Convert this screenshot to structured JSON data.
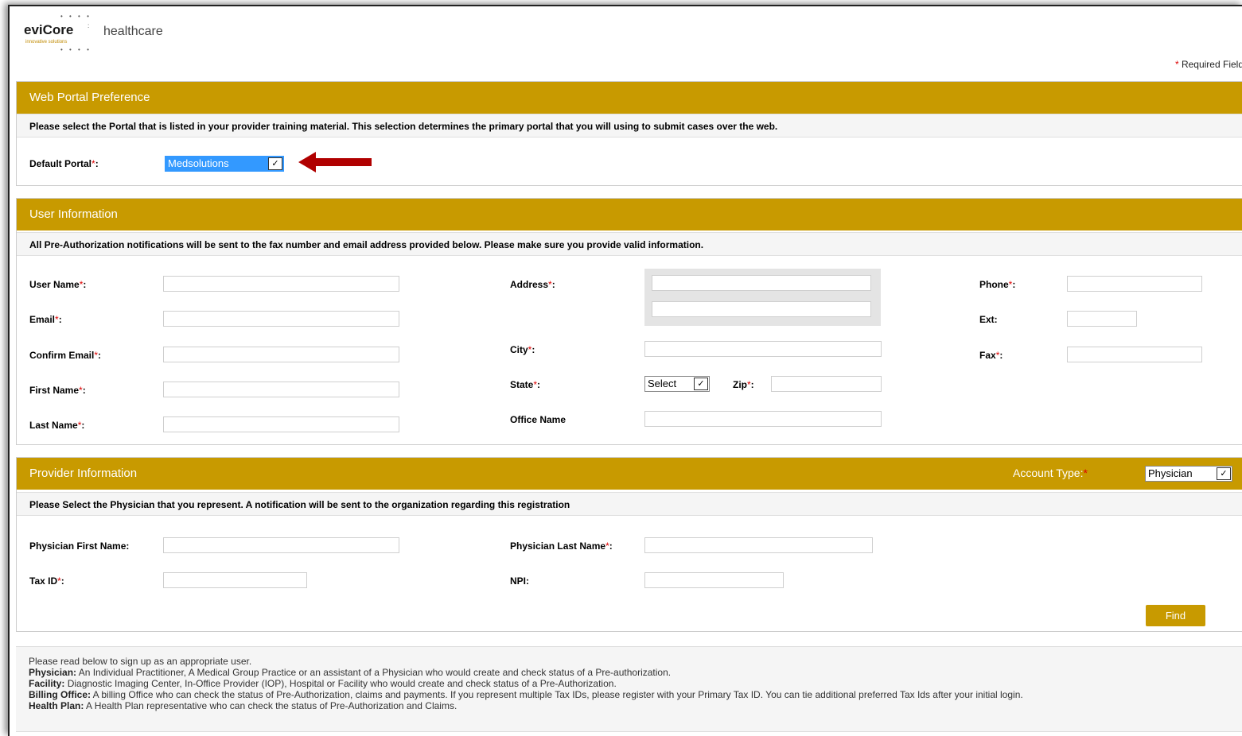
{
  "branding": {
    "logo_name": "eviCore",
    "logo_suffix": "healthcare",
    "logo_tagline": "innovative solutions"
  },
  "required_note": {
    "star": "*",
    "text": "Required Field"
  },
  "web_portal": {
    "title": "Web Portal Preference",
    "note": "Please select the Portal that is listed in your provider training material. This selection determines the primary portal that you will using to submit cases over the web.",
    "default_portal_label": "Default Portal",
    "default_portal_value": "Medsolutions",
    "arrow_color": "#b00000"
  },
  "user_info": {
    "title": "User Information",
    "note": "All Pre-Authorization notifications will be sent to the fax number and email address provided below. Please make sure you provide valid information.",
    "labels": {
      "user_name": "User Name",
      "email": "Email",
      "confirm_email": "Confirm Email",
      "first_name": "First Name",
      "last_name": "Last Name",
      "address": "Address",
      "city": "City",
      "state": "State",
      "zip": "Zip",
      "office_name": "Office Name",
      "phone": "Phone",
      "ext": "Ext:",
      "fax": "Fax"
    },
    "state_value": "Select"
  },
  "provider_info": {
    "title": "Provider Information",
    "account_type_label": "Account Type:",
    "account_type_value": "Physician",
    "note": "Please Select the Physician that you represent. A notification will be sent to the organization regarding this registration",
    "labels": {
      "physician_first_name": "Physician First Name:",
      "physician_last_name": "Physician Last Name",
      "tax_id": "Tax ID",
      "npi": "NPI:"
    },
    "find_button": "Find"
  },
  "help": {
    "intro": "Please read below to sign up as an appropriate user.",
    "items": [
      {
        "term": "Physician:",
        "desc": " An Individual Practitioner, A Medical Group Practice or an assistant of a Physician who would create and check status of a Pre-authorization."
      },
      {
        "term": "Facility:",
        "desc": " Diagnostic Imaging Center, In-Office Provider (IOP), Hospital or Facility who would create and check status of a Pre-Authorization."
      },
      {
        "term": "Billing Office:",
        "desc": " A billing Office who can check the status of Pre-Authorization, claims and payments. If you represent multiple Tax IDs, please register with your Primary Tax ID. You can tie additional preferred Tax Ids after your initial login."
      },
      {
        "term": "Health Plan:",
        "desc": " A Health Plan representative who can check the status of Pre-Authorization and Claims."
      }
    ]
  },
  "colors": {
    "header": "#c89a00",
    "required": "#dd0000",
    "highlight": "#3399ff"
  }
}
